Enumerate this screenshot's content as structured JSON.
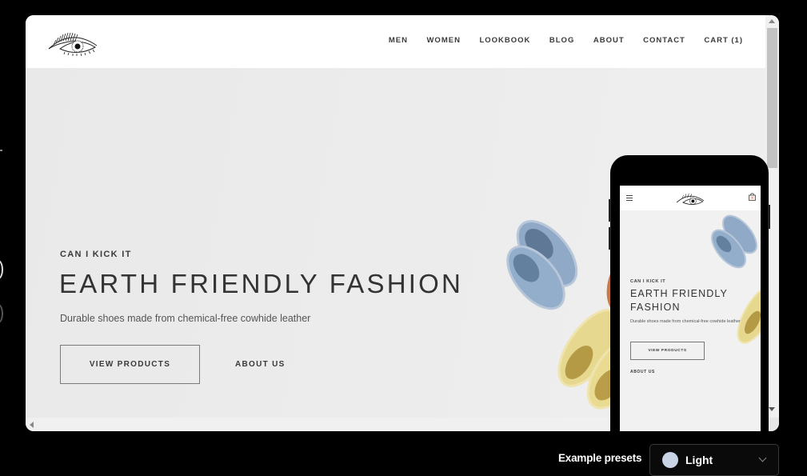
{
  "site": {
    "logo_alt": "eye-logo",
    "nav": [
      {
        "label": "MEN"
      },
      {
        "label": "WOMEN"
      },
      {
        "label": "LOOKBOOK"
      },
      {
        "label": "BLOG"
      },
      {
        "label": "ABOUT"
      },
      {
        "label": "CONTACT"
      },
      {
        "label": "CART (1)"
      }
    ],
    "hero": {
      "eyebrow": "CAN I KICK IT",
      "headline": "EARTH FRIENDLY FASHION",
      "subline": "Durable shoes made from chemical-free cowhide leather",
      "primary_button": "VIEW PRODUCTS",
      "secondary_link": "ABOUT US"
    }
  },
  "mobile_preview": {
    "eyebrow": "CAN I KICK IT",
    "headline": "EARTH FRIENDLY FASHION",
    "subline": "Durable shoes made from chemical-free cowhide leather",
    "primary_button": "VIEW PRODUCTS",
    "secondary_link": "ABOUT US"
  },
  "presets": {
    "label": "Example presets",
    "selected": "Light",
    "swatch_color": "#c8d3e6"
  }
}
